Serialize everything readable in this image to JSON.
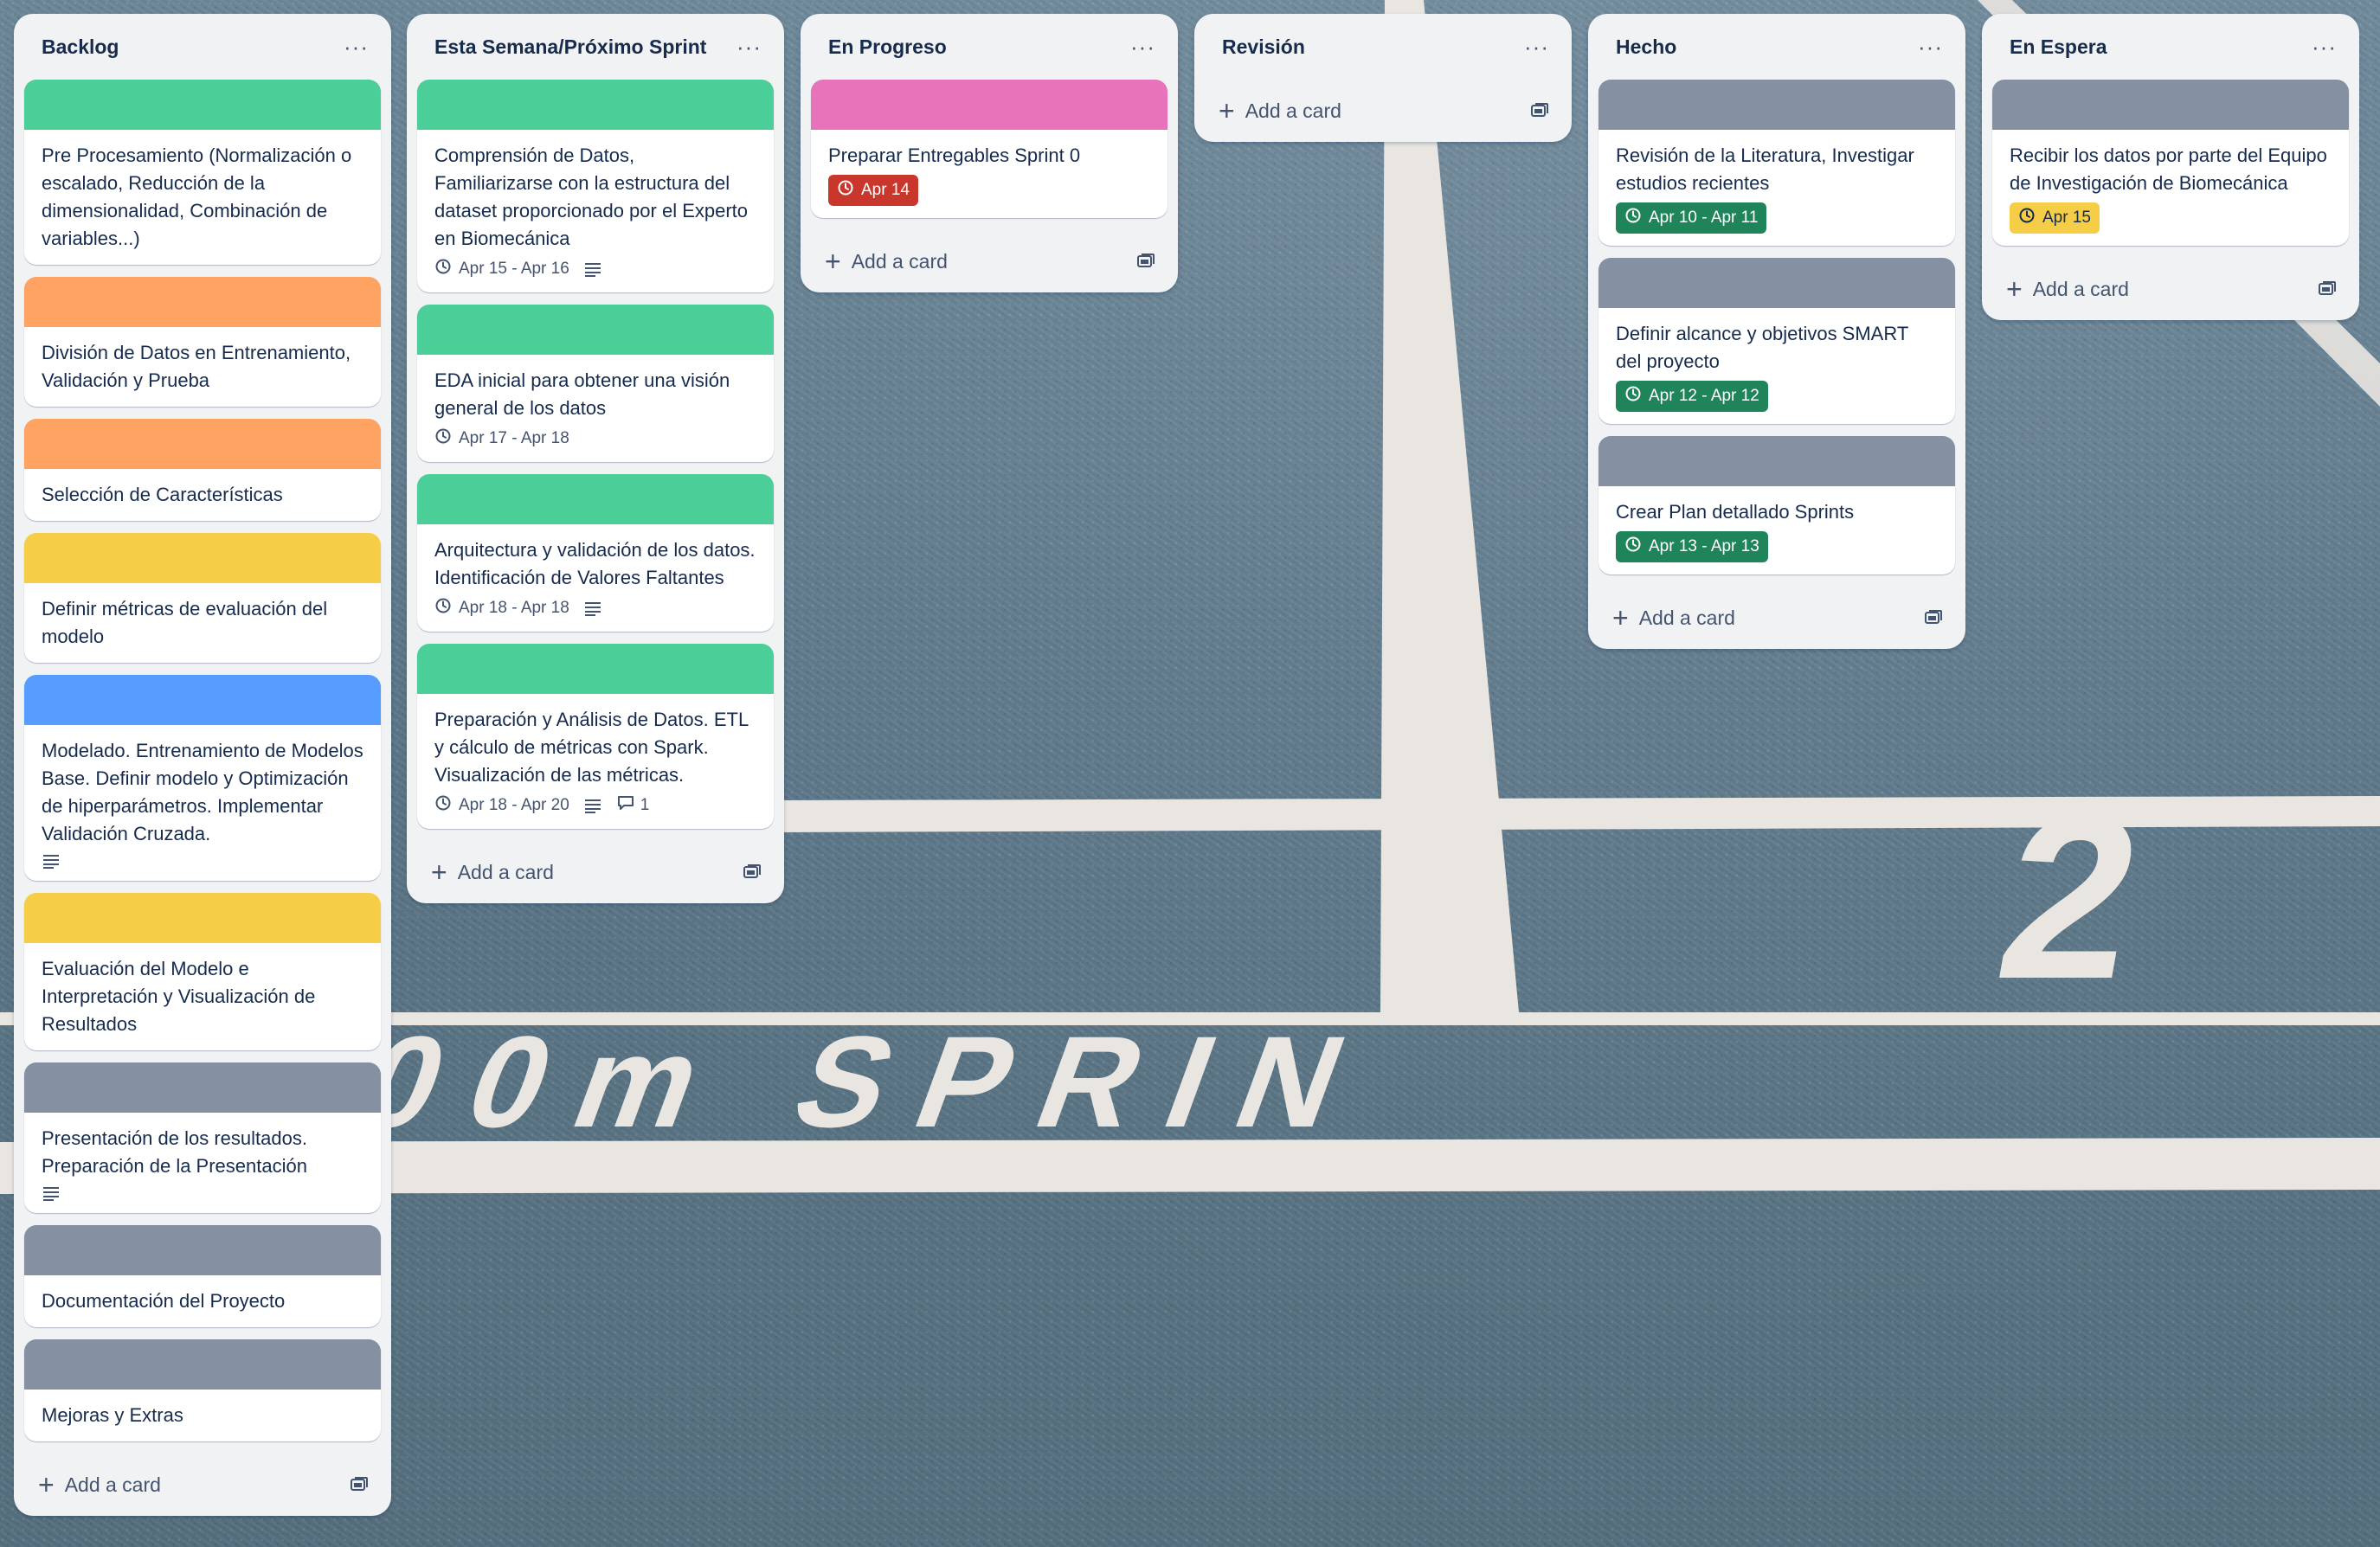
{
  "colors": {
    "green": "#4bce97",
    "orange": "#fea362",
    "yellow": "#f5cd47",
    "blue": "#579dff",
    "pink": "#e774bb",
    "gray": "#8590a2",
    "due_done": "#1f845a",
    "due_overdue": "#c9372c",
    "due_soon": "#f5cd47"
  },
  "background": {
    "track_text": "00m SPRIN",
    "lane_number": "2"
  },
  "add_card_label": "Add a card",
  "menu_label": "···",
  "lists": [
    {
      "title": "Backlog",
      "cards": [
        {
          "cover": "green",
          "title": "Pre Procesamiento (Normalización o escalado, Reducción de la dimensionalidad, Combinación de variables...)"
        },
        {
          "cover": "orange",
          "title": "División de Datos en Entrenamiento, Validación y Prueba"
        },
        {
          "cover": "orange",
          "title": "Selección de Características"
        },
        {
          "cover": "yellow",
          "title": "Definir métricas de evaluación del modelo"
        },
        {
          "cover": "blue",
          "title": "Modelado. Entrenamiento de Modelos Base. Definir modelo y Optimización de hiperparámetros. Implementar Validación Cruzada.",
          "description": true
        },
        {
          "cover": "yellow",
          "title": "Evaluación del Modelo e Interpretación y Visualización de Resultados"
        },
        {
          "cover": "gray",
          "title": "Presentación de los resultados. Preparación de la Presentación",
          "description": true
        },
        {
          "cover": "gray",
          "title": "Documentación del Proyecto"
        },
        {
          "cover": "gray",
          "title": "Mejoras y Extras"
        }
      ]
    },
    {
      "title": "Esta Semana/Próximo Sprint",
      "cards": [
        {
          "cover": "green",
          "title": "Comprensión de Datos, Familiarizarse con la estructura del dataset proporcionado por el Experto en Biomecánica",
          "date": "Apr 15 - Apr 16",
          "date_style": "plain",
          "description": true
        },
        {
          "cover": "green",
          "title": "EDA inicial para obtener una visión general de los datos",
          "date": "Apr 17 - Apr 18",
          "date_style": "plain"
        },
        {
          "cover": "green",
          "title": "Arquitectura y validación de los datos. Identificación de Valores Faltantes",
          "date": "Apr 18 - Apr 18",
          "date_style": "plain",
          "description": true
        },
        {
          "cover": "green",
          "title": "Preparación y Análisis de Datos. ETL y cálculo de métricas con Spark. Visualización de las métricas.",
          "date": "Apr 18 - Apr 20",
          "date_style": "plain",
          "description": true,
          "comments": "1"
        }
      ]
    },
    {
      "title": "En Progreso",
      "cards": [
        {
          "cover": "pink",
          "title": "Preparar Entregables Sprint 0",
          "date": "Apr 14",
          "date_style": "red"
        }
      ]
    },
    {
      "title": "Revisión",
      "cards": []
    },
    {
      "title": "Hecho",
      "cards": [
        {
          "cover": "gray",
          "title": "Revisión de la Literatura, Investigar estudios recientes",
          "date": "Apr 10 - Apr 11",
          "date_style": "green"
        },
        {
          "cover": "gray",
          "title": "Definir alcance y objetivos SMART del proyecto",
          "date": "Apr 12 - Apr 12",
          "date_style": "green"
        },
        {
          "cover": "gray",
          "title": "Crear Plan detallado Sprints",
          "date": "Apr 13 - Apr 13",
          "date_style": "green"
        }
      ]
    },
    {
      "title": "En Espera",
      "cards": [
        {
          "cover": "gray",
          "title": "Recibir los datos por parte del Equipo de Investigación de Biomecánica",
          "date": "Apr 15",
          "date_style": "yellow"
        }
      ]
    }
  ]
}
